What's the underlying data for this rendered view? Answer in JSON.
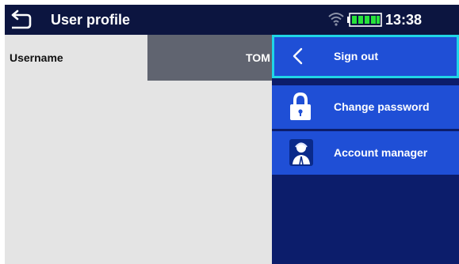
{
  "header": {
    "title": "User profile",
    "time": "13:38",
    "back_icon": "back-arrow-icon",
    "wifi_icon": "wifi-icon",
    "battery_icon": "battery-icon"
  },
  "profile": {
    "username_label": "Username",
    "username_value": "TOM"
  },
  "menu": {
    "items": [
      {
        "label": "Sign out",
        "icon": "chevron-left-icon",
        "selected": true
      },
      {
        "label": "Change password",
        "icon": "lock-icon",
        "selected": false
      },
      {
        "label": "Account manager",
        "icon": "account-manager-icon",
        "selected": false
      }
    ]
  },
  "colors": {
    "titlebar": "#0c1540",
    "menu_bg": "#0c1d6b",
    "menu_item": "#1f4fd6",
    "selected_border": "#20d6e6",
    "battery_green": "#27e23a"
  }
}
